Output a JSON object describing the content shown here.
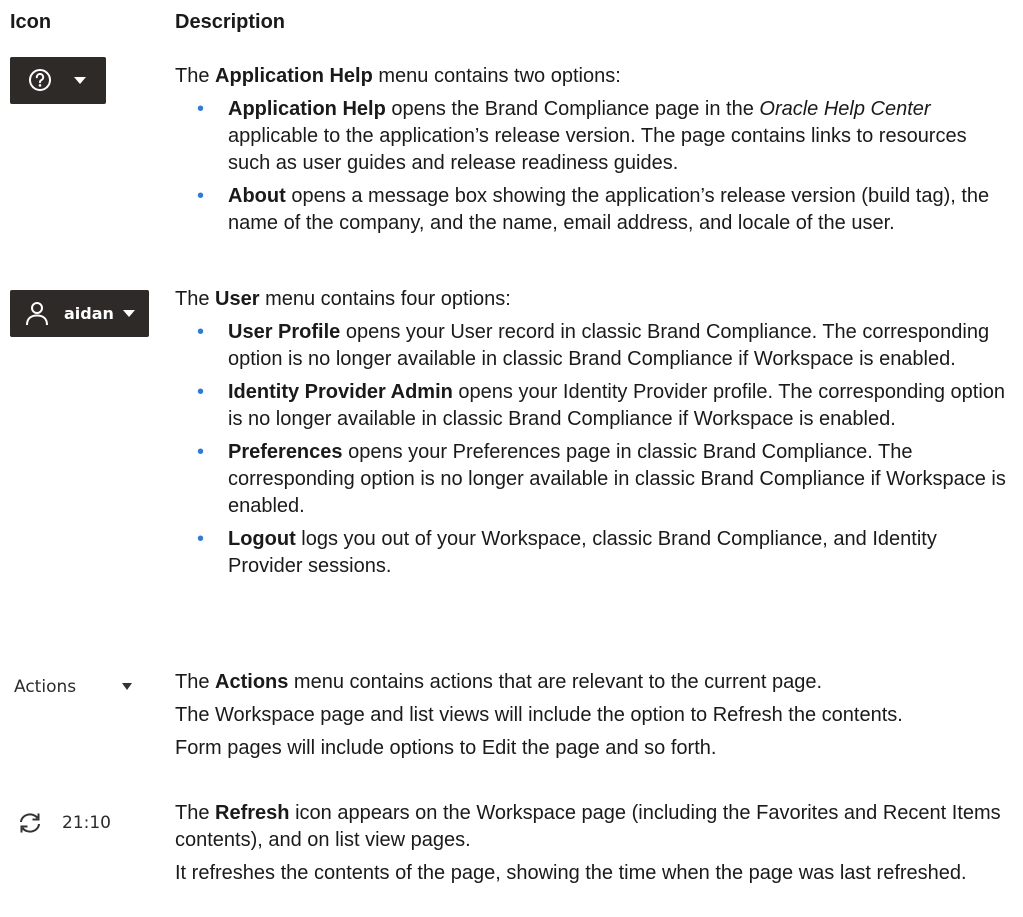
{
  "headers": {
    "icon": "Icon",
    "description": "Description"
  },
  "rows": {
    "help": {
      "icon": "question-circle-icon",
      "intro": {
        "pre": "The ",
        "bold": "Application Help",
        "post": " menu contains two options:"
      },
      "items": [
        {
          "bold": "Application Help",
          "t1": " opens the Brand Compliance page in the ",
          "italic": "Oracle Help Center",
          "t2": " applicable to the application’s release version. The page contains links to resources such as user guides and release readiness guides."
        },
        {
          "bold": "About",
          "text": " opens a message box showing the application’s release version (build tag), the name of the company, and the name, email address, and locale of the user."
        }
      ]
    },
    "user": {
      "icon": "user-icon",
      "username": "aidan",
      "intro": {
        "pre": "The ",
        "bold": "User",
        "post": " menu contains four options:"
      },
      "items": [
        {
          "bold": "User Profile",
          "text": " opens your User record in classic Brand Compliance. The corresponding option is no longer available in classic Brand Compliance if Workspace is enabled."
        },
        {
          "bold": "Identity Provider Admin",
          "text": " opens your Identity Provider profile. The corresponding option is no longer available in classic Brand Compliance if Workspace is enabled."
        },
        {
          "bold": "Preferences",
          "text": " opens your Preferences page in classic Brand Compliance. The corresponding option is no longer available in classic Brand Compliance if Workspace is enabled."
        },
        {
          "bold": "Logout",
          "text": " logs you out of your Workspace, classic Brand Compliance, and Identity Provider sessions."
        }
      ]
    },
    "actions": {
      "label": "Actions",
      "intro": {
        "pre": "The ",
        "bold": "Actions",
        "post": " menu contains actions that are relevant to the current page."
      },
      "para2": "The Workspace page and list views will include the option to Refresh the contents.",
      "para3": "Form pages will include options to Edit the page and so forth."
    },
    "refresh": {
      "icon": "refresh-icon",
      "time": "21:10",
      "intro": {
        "pre": "The ",
        "bold": "Refresh",
        "post": " icon appears on the Workspace page (including the Favorites and Recent Items contents), and on list view pages."
      },
      "para2": "It refreshes the contents of the page, showing the time when the page was last refreshed."
    }
  },
  "bullet": "•",
  "colors": {
    "bullet": "#2f7bd6",
    "icon_bg": "#2e2a27"
  }
}
